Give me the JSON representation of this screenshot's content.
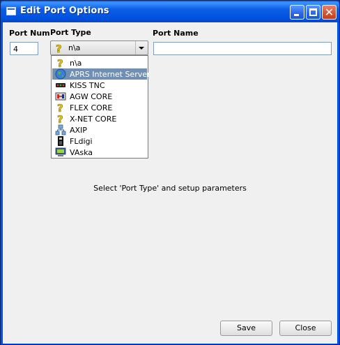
{
  "window": {
    "title": "Edit Port Options",
    "controls": [
      "minimize-icon",
      "maximize-icon",
      "close-icon"
    ]
  },
  "form": {
    "port_num_label": "Port Num",
    "port_num_value": "4",
    "port_type_label": "Port Type",
    "port_type_value": "n\\a",
    "port_name_label": "Port Name",
    "port_name_value": ""
  },
  "dropdown": {
    "options": [
      {
        "label": "n\\a",
        "icon": "question-icon"
      },
      {
        "label": "APRS Internet Server",
        "icon": "globe-icon",
        "selected": true
      },
      {
        "label": "KISS TNC",
        "icon": "tnc-icon"
      },
      {
        "label": "AGW CORE",
        "icon": "agw-icon"
      },
      {
        "label": "FLEX CORE",
        "icon": "question-icon"
      },
      {
        "label": "X-NET CORE",
        "icon": "question-icon"
      },
      {
        "label": "AXIP",
        "icon": "network-icon"
      },
      {
        "label": "FLdigi",
        "icon": "radio-icon"
      },
      {
        "label": "VAska",
        "icon": "computer-icon"
      }
    ]
  },
  "status_message": "Select 'Port Type' and setup parameters",
  "buttons": {
    "save": "Save",
    "close": "Close"
  },
  "colors": {
    "titlebar": "#0054e3",
    "selection": "#6f8fb3",
    "background": "#f0f0f0"
  }
}
